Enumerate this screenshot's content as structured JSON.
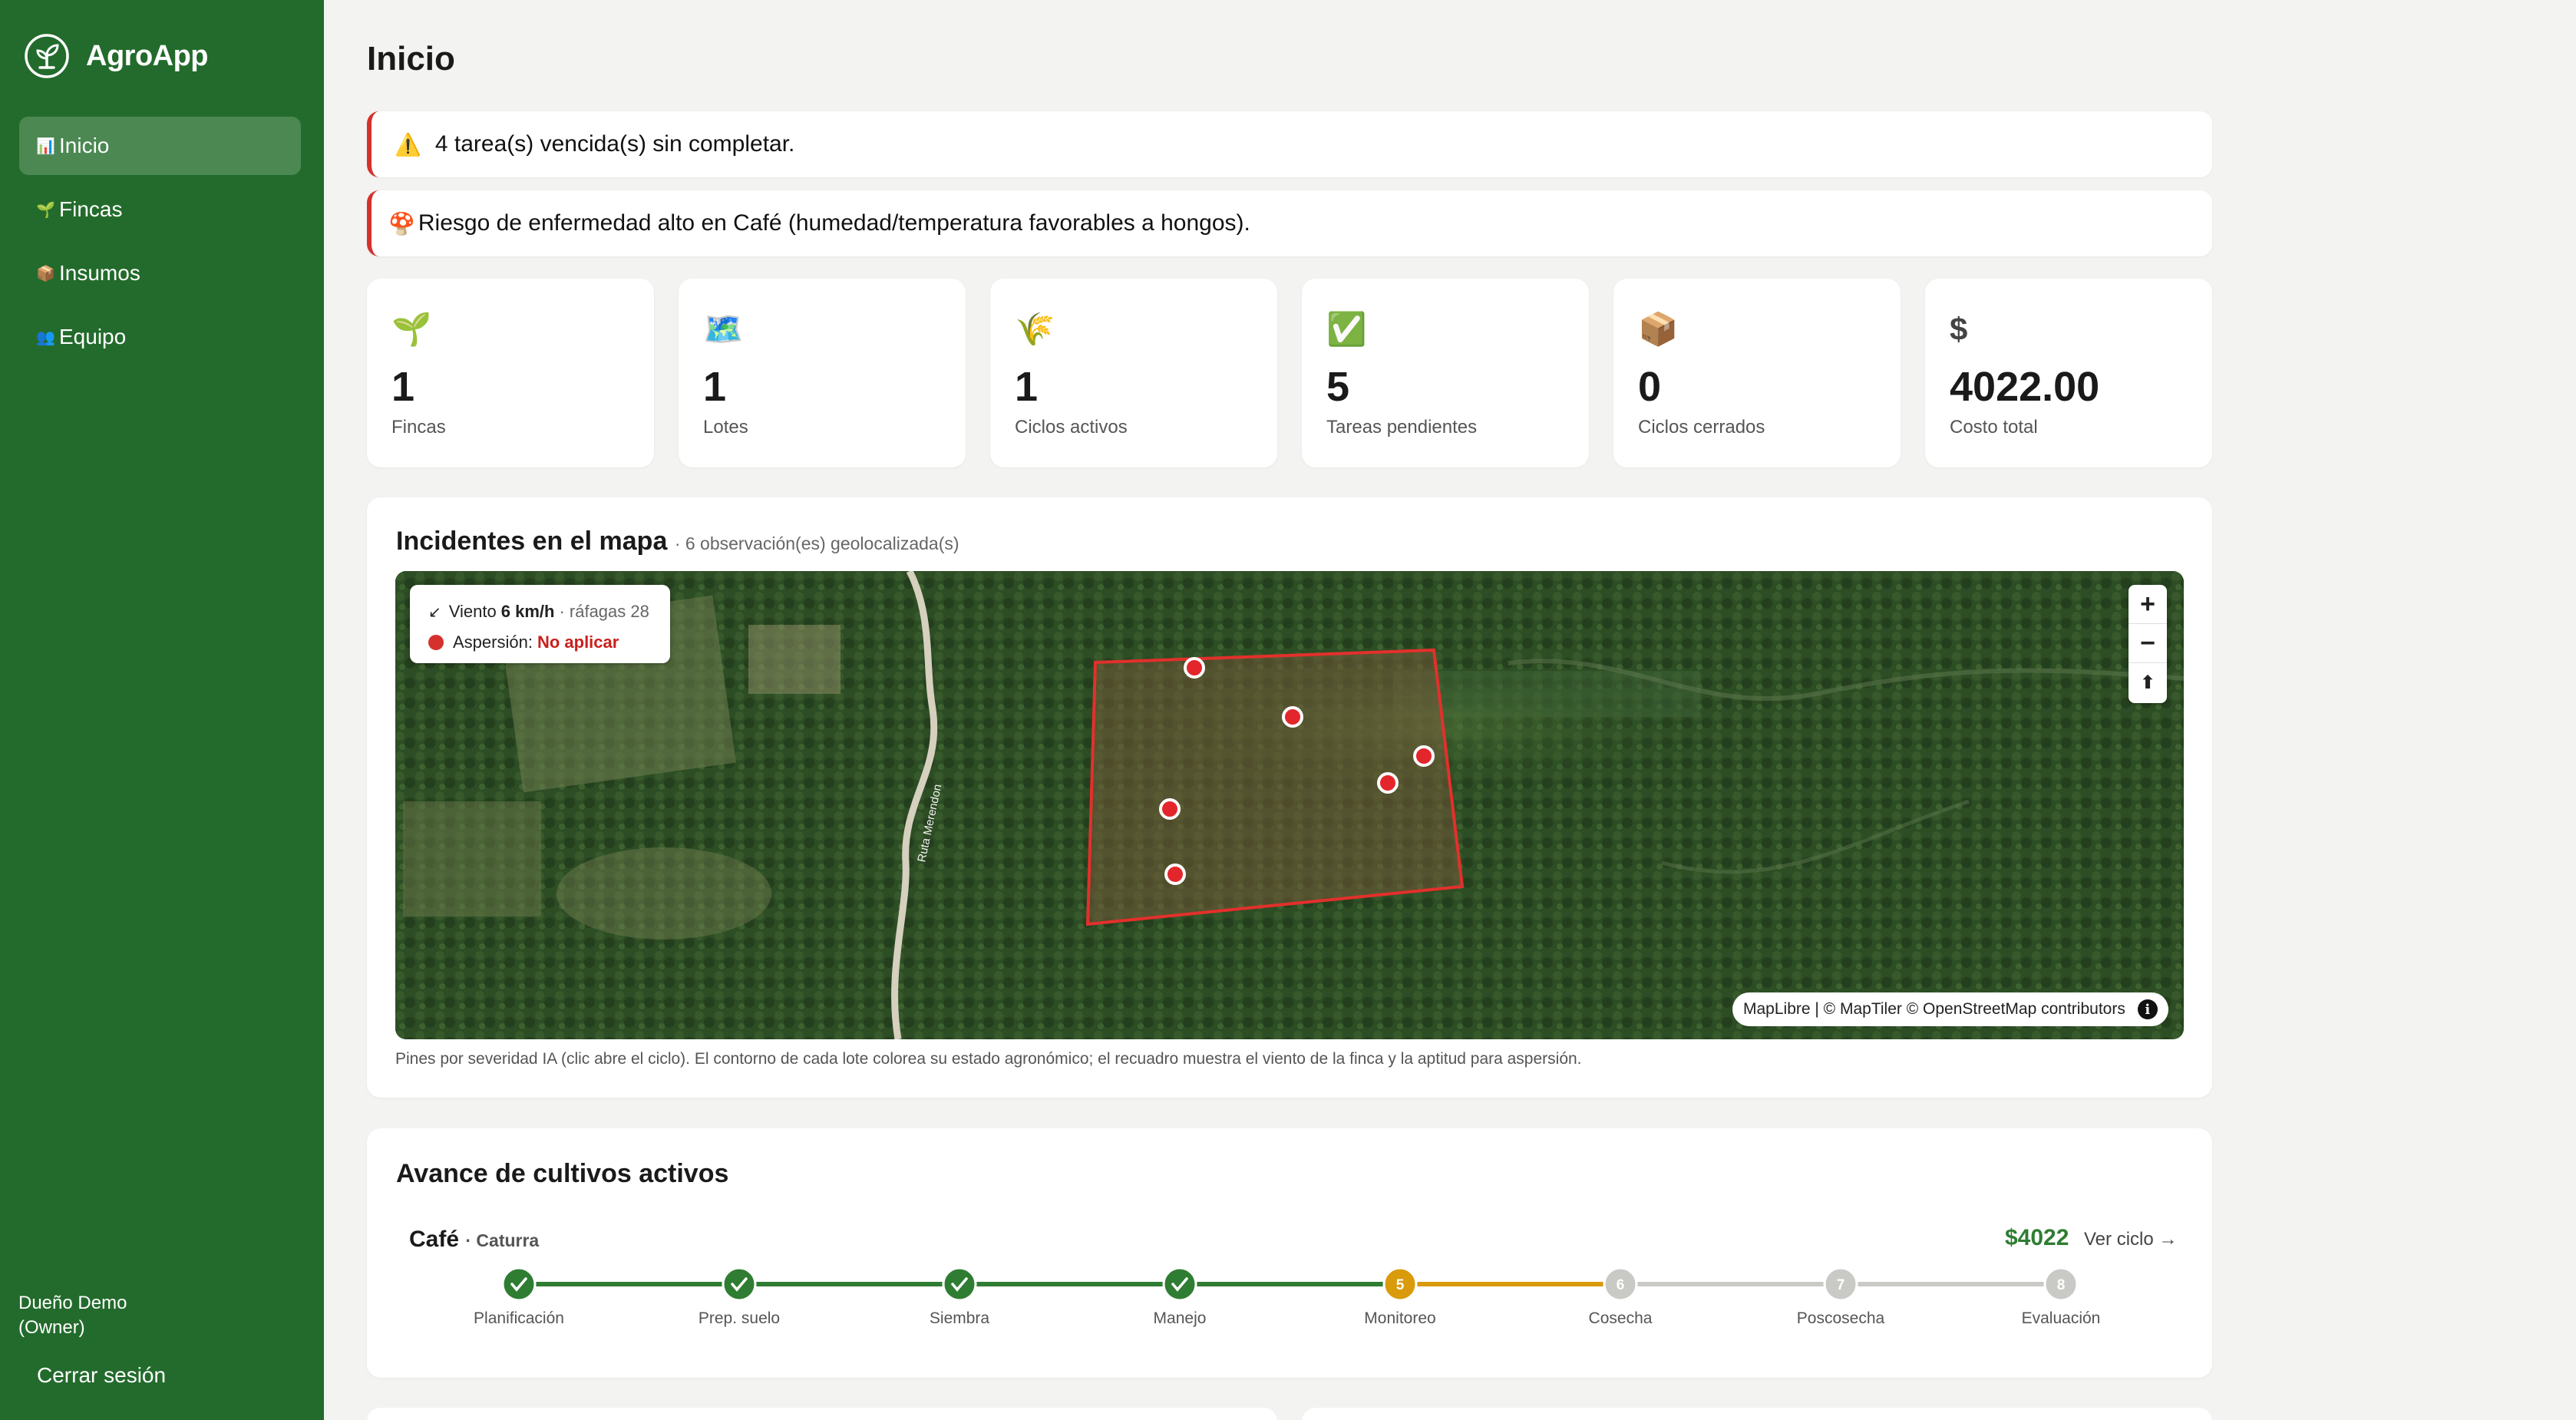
{
  "app": {
    "name": "AgroApp"
  },
  "nav": [
    {
      "icon": "📊",
      "label": "Inicio",
      "active": true
    },
    {
      "icon": "🌱",
      "label": "Fincas"
    },
    {
      "icon": "📦",
      "label": "Insumos"
    },
    {
      "icon": "👥",
      "label": "Equipo"
    }
  ],
  "user": {
    "name": "Dueño Demo",
    "role": "(Owner)",
    "logout_label": "Cerrar sesión"
  },
  "page": {
    "title": "Inicio"
  },
  "alerts": [
    {
      "icon": "⚠️",
      "text": "4 tarea(s) vencida(s) sin completar."
    },
    {
      "icon": "🍄",
      "text": "Riesgo de enfermedad alto en Café (humedad/temperatura favorables a hongos)."
    }
  ],
  "stats": [
    {
      "icon": "🌱",
      "value": "1",
      "label": "Fincas"
    },
    {
      "icon": "🗺️",
      "value": "1",
      "label": "Lotes"
    },
    {
      "icon": "🌾",
      "value": "1",
      "label": "Ciclos activos"
    },
    {
      "icon": "✅",
      "value": "5",
      "label": "Tareas pendientes"
    },
    {
      "icon": "📦",
      "value": "0",
      "label": "Ciclos cerrados"
    },
    {
      "icon": "$",
      "value": "4022.00",
      "label": "Costo total"
    }
  ],
  "map_card": {
    "title": "Incidentes en el mapa",
    "subtitle": "· 6 observación(es) geolocalizada(s)",
    "wind": {
      "arrow": "↙",
      "prefix": "Viento",
      "speed": "6 km/h",
      "gusts": "· ráfagas 28"
    },
    "spray": {
      "label": "Aspersión:",
      "value": "No aplicar"
    },
    "road_label": "Ruta Merendon",
    "zoom_in": "+",
    "zoom_out": "−",
    "compass": "⬆",
    "attribution": "MapLibre | © MapTiler © OpenStreetMap contributors",
    "info": "i",
    "caption": "Pines por severidad IA (clic abre el ciclo). El contorno de cada lote colorea su estado agronómico; el recuadro muestra el viento de la finca y la aptitud para aspersión.",
    "pin_count": 6
  },
  "progress_card": {
    "title": "Avance de cultivos activos",
    "crop": {
      "name": "Café",
      "variety": "· Caturra",
      "cost": "$4022",
      "link": "Ver ciclo →"
    },
    "current_step": 5,
    "steps": [
      {
        "num": "1",
        "label": "Planificación",
        "state": "done"
      },
      {
        "num": "2",
        "label": "Prep. suelo",
        "state": "done"
      },
      {
        "num": "3",
        "label": "Siembra",
        "state": "done"
      },
      {
        "num": "4",
        "label": "Manejo",
        "state": "done"
      },
      {
        "num": "5",
        "label": "Monitoreo",
        "state": "current"
      },
      {
        "num": "6",
        "label": "Cosecha",
        "state": "pending"
      },
      {
        "num": "7",
        "label": "Poscosecha",
        "state": "pending"
      },
      {
        "num": "8",
        "label": "Evaluación",
        "state": "pending"
      }
    ],
    "colors": {
      "done": "#2f7d32",
      "current": "#d99a0c",
      "pending": "#c9c9c6"
    }
  }
}
